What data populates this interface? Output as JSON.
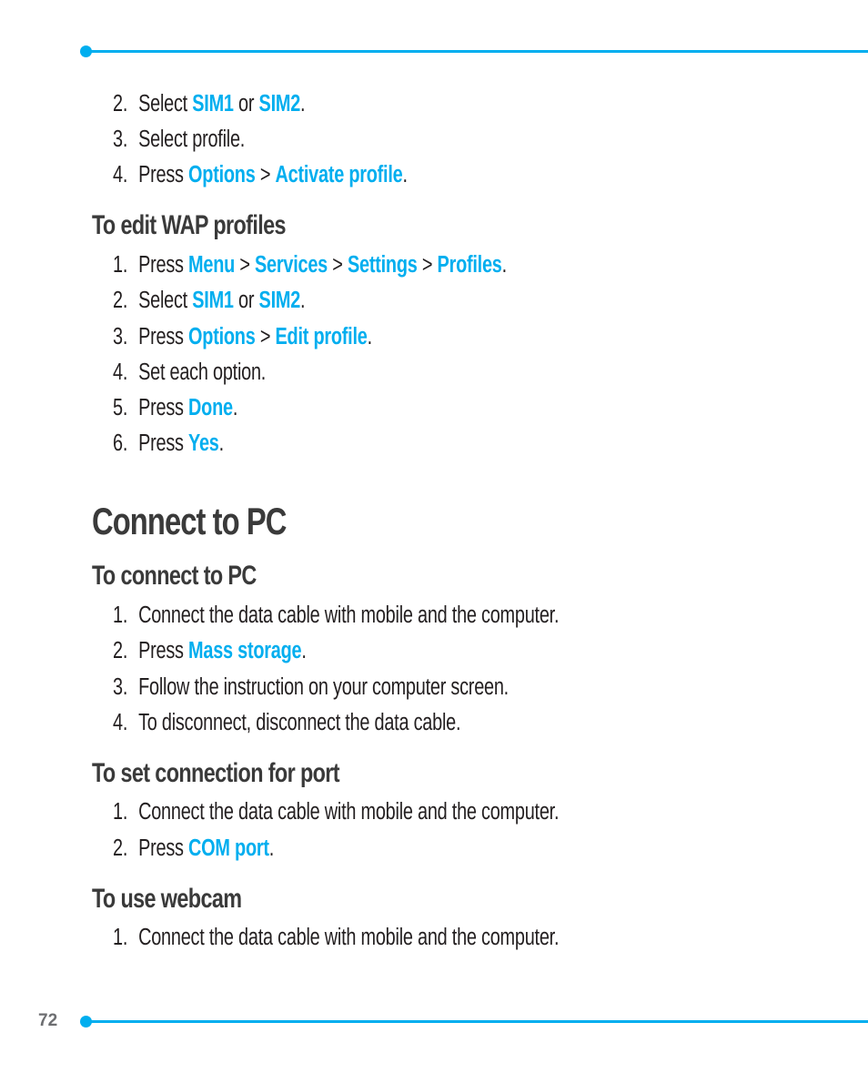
{
  "page_number": "72",
  "accent_color": "#00aeef",
  "top_steps": [
    {
      "n": "2.",
      "parts": [
        {
          "t": "Select "
        },
        {
          "k": "SIM1"
        },
        {
          "t": " or "
        },
        {
          "k": "SIM2"
        },
        {
          "t": "."
        }
      ]
    },
    {
      "n": "3.",
      "parts": [
        {
          "t": "Select profile."
        }
      ]
    },
    {
      "n": "4.",
      "parts": [
        {
          "t": "Press "
        },
        {
          "k": "Options"
        },
        {
          "t": " > "
        },
        {
          "k": "Activate profile"
        },
        {
          "t": "."
        }
      ]
    }
  ],
  "sections": {
    "edit_wap": {
      "heading": "To edit WAP profiles",
      "steps": [
        {
          "n": "1.",
          "parts": [
            {
              "t": "Press "
            },
            {
              "k": "Menu"
            },
            {
              "t": " > "
            },
            {
              "k": "Services"
            },
            {
              "t": " > "
            },
            {
              "k": "Settings"
            },
            {
              "t": " > "
            },
            {
              "k": "Profiles"
            },
            {
              "t": "."
            }
          ]
        },
        {
          "n": "2.",
          "parts": [
            {
              "t": "Select "
            },
            {
              "k": "SIM1"
            },
            {
              "t": " or "
            },
            {
              "k": "SIM2"
            },
            {
              "t": "."
            }
          ]
        },
        {
          "n": "3.",
          "parts": [
            {
              "t": "Press "
            },
            {
              "k": "Options"
            },
            {
              "t": " > "
            },
            {
              "k": "Edit profile"
            },
            {
              "t": "."
            }
          ]
        },
        {
          "n": "4.",
          "parts": [
            {
              "t": "Set each option."
            }
          ]
        },
        {
          "n": "5.",
          "parts": [
            {
              "t": "Press "
            },
            {
              "k": "Done"
            },
            {
              "t": "."
            }
          ]
        },
        {
          "n": "6.",
          "parts": [
            {
              "t": "Press "
            },
            {
              "k": "Yes"
            },
            {
              "t": "."
            }
          ]
        }
      ]
    },
    "connect_pc_title": "Connect to PC",
    "connect": {
      "heading": "To connect to PC",
      "steps": [
        {
          "n": "1.",
          "parts": [
            {
              "t": "Connect the data cable with mobile and the computer."
            }
          ]
        },
        {
          "n": "2.",
          "parts": [
            {
              "t": "Press "
            },
            {
              "k": "Mass storage"
            },
            {
              "t": "."
            }
          ]
        },
        {
          "n": "3.",
          "parts": [
            {
              "t": "Follow the instruction on your computer screen."
            }
          ]
        },
        {
          "n": "4.",
          "parts": [
            {
              "t": "To disconnect, disconnect the data cable."
            }
          ]
        }
      ]
    },
    "port": {
      "heading": "To set connection for port",
      "steps": [
        {
          "n": "1.",
          "parts": [
            {
              "t": "Connect the data cable with mobile and the computer."
            }
          ]
        },
        {
          "n": "2.",
          "parts": [
            {
              "t": "Press "
            },
            {
              "k": "COM port"
            },
            {
              "t": "."
            }
          ]
        }
      ]
    },
    "webcam": {
      "heading": "To use webcam",
      "steps": [
        {
          "n": "1.",
          "parts": [
            {
              "t": "Connect the data cable with mobile and the computer."
            }
          ]
        }
      ]
    }
  }
}
